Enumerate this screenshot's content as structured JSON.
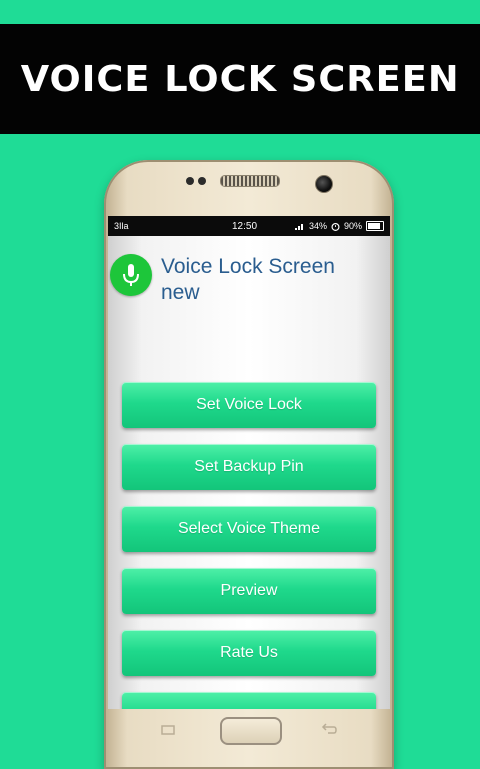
{
  "banner": {
    "title": "VOICE LOCK SCREEN"
  },
  "statusbar": {
    "left_indicator": "3Ila",
    "time": "12:50",
    "battery_left": "34%",
    "battery_right": "90%"
  },
  "app": {
    "title": "Voice Lock Screen new",
    "icon": "microphone-icon"
  },
  "menu": {
    "items": [
      {
        "label": "Set Voice Lock"
      },
      {
        "label": "Set Backup Pin"
      },
      {
        "label": "Select Voice Theme"
      },
      {
        "label": "Preview"
      },
      {
        "label": "Rate Us"
      },
      {
        "label": ""
      }
    ]
  },
  "colors": {
    "background": "#1fdc96",
    "banner": "#030303",
    "button": "#1fd98c",
    "mic": "#1dc63a",
    "title": "#2a5d8f"
  }
}
